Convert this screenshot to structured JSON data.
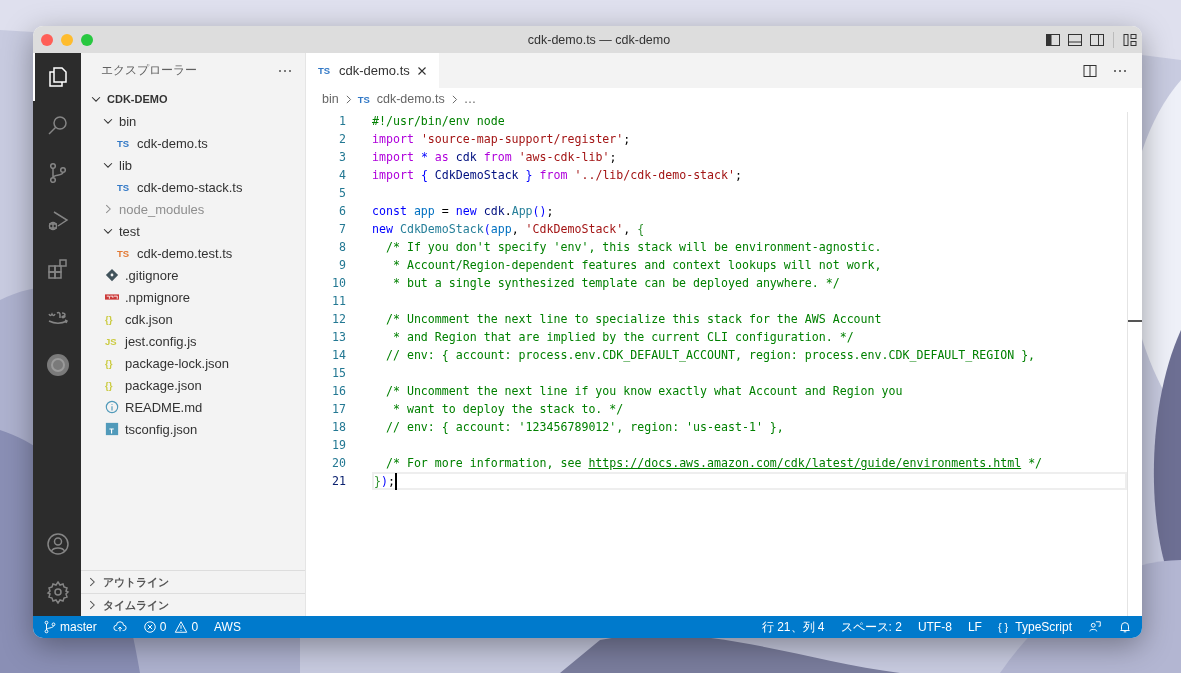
{
  "window": {
    "title": "cdk-demo.ts — cdk-demo"
  },
  "activity_bar": {
    "top": [
      {
        "selected": true
      },
      {
        "selected": false
      },
      {
        "selected": false
      },
      {
        "selected": false
      },
      {
        "selected": false
      },
      {
        "selected": false
      },
      {
        "selected": false
      }
    ]
  },
  "sidebar": {
    "title": "エクスプローラー",
    "tree": [
      {
        "label": "CDK-DEMO",
        "kind": "root",
        "expanded": true,
        "children": [
          {
            "label": "bin",
            "kind": "folder",
            "expanded": true,
            "children": [
              {
                "label": "cdk-demo.ts",
                "kind": "ts",
                "badge": "TS"
              }
            ]
          },
          {
            "label": "lib",
            "kind": "folder",
            "expanded": true,
            "children": [
              {
                "label": "cdk-demo-stack.ts",
                "kind": "ts",
                "badge": "TS"
              }
            ]
          },
          {
            "label": "node_modules",
            "kind": "folder",
            "expanded": false,
            "ignored": true
          },
          {
            "label": "test",
            "kind": "folder",
            "expanded": true,
            "children": [
              {
                "label": "cdk-demo.test.ts",
                "kind": "test",
                "badge": "TS"
              }
            ]
          },
          {
            "label": ".gitignore",
            "kind": "git"
          },
          {
            "label": ".npmignore",
            "kind": "npm"
          },
          {
            "label": "cdk.json",
            "kind": "json",
            "badge": "{}"
          },
          {
            "label": "jest.config.js",
            "kind": "js",
            "badge": "JS"
          },
          {
            "label": "package-lock.json",
            "kind": "json",
            "badge": "{}"
          },
          {
            "label": "package.json",
            "kind": "json",
            "badge": "{}"
          },
          {
            "label": "README.md",
            "kind": "info"
          },
          {
            "label": "tsconfig.json",
            "kind": "tsconfig"
          }
        ]
      }
    ],
    "panes": [
      {
        "label": "アウトライン",
        "expanded": false
      },
      {
        "label": "タイムライン",
        "expanded": false
      }
    ]
  },
  "tabs": [
    {
      "badge": "TS",
      "label": "cdk-demo.ts",
      "selected": true
    }
  ],
  "breadcrumb": [
    {
      "label": "bin"
    },
    {
      "badge": "TS",
      "label": "cdk-demo.ts"
    },
    {
      "label": "…"
    }
  ],
  "editor": {
    "lines": [
      {
        "n": "1",
        "current": false,
        "tokens": [
          {
            "kind": "comment",
            "text": "#!/usr/bin/env node"
          }
        ]
      },
      {
        "n": "2",
        "current": false,
        "tokens": [
          {
            "kind": "keyword",
            "text": "import "
          },
          {
            "kind": "string",
            "text": "'source-map-support/register'"
          },
          {
            "kind": "plain",
            "text": ";"
          }
        ]
      },
      {
        "n": "3",
        "current": false,
        "tokens": [
          {
            "kind": "keyword",
            "text": "import "
          },
          {
            "kind": "storage",
            "text": "* "
          },
          {
            "kind": "keyword",
            "text": "as "
          },
          {
            "kind": "variable",
            "text": "cdk "
          },
          {
            "kind": "keyword",
            "text": "from "
          },
          {
            "kind": "string",
            "text": "'aws-cdk-lib'"
          },
          {
            "kind": "plain",
            "text": ";"
          }
        ]
      },
      {
        "n": "4",
        "current": false,
        "tokens": [
          {
            "kind": "keyword",
            "text": "import "
          },
          {
            "kind": "storage",
            "text": "{ "
          },
          {
            "kind": "variable",
            "text": "CdkDemoStack "
          },
          {
            "kind": "storage",
            "text": "} "
          },
          {
            "kind": "keyword",
            "text": "from "
          },
          {
            "kind": "string",
            "text": "'../lib/cdk-demo-stack'"
          },
          {
            "kind": "plain",
            "text": ";"
          }
        ]
      },
      {
        "n": "5",
        "current": false
      },
      {
        "n": "6",
        "current": false,
        "tokens": [
          {
            "kind": "storage",
            "text": "const "
          },
          {
            "kind": "constant",
            "text": "app"
          },
          {
            "kind": "plain",
            "text": " = "
          },
          {
            "kind": "storage",
            "text": "new "
          },
          {
            "kind": "variable",
            "text": "cdk"
          },
          {
            "kind": "plain",
            "text": "."
          },
          {
            "kind": "type",
            "text": "App"
          },
          {
            "kind": "storage",
            "text": "()"
          },
          {
            "kind": "plain",
            "text": ";"
          }
        ]
      },
      {
        "n": "7",
        "current": false,
        "tokens": [
          {
            "kind": "storage",
            "text": "new "
          },
          {
            "kind": "type",
            "text": "CdkDemoStack"
          },
          {
            "kind": "storage",
            "text": "("
          },
          {
            "kind": "constant",
            "text": "app"
          },
          {
            "kind": "plain",
            "text": ", "
          },
          {
            "kind": "string",
            "text": "'CdkDemoStack'"
          },
          {
            "kind": "plain",
            "text": ", "
          },
          {
            "kind": "bracket",
            "text": "{"
          }
        ]
      },
      {
        "n": "8",
        "current": false,
        "tokens": [
          {
            "kind": "comment",
            "text": "  /* If you don't specify 'env', this stack will be environment-agnostic."
          }
        ]
      },
      {
        "n": "9",
        "current": false,
        "tokens": [
          {
            "kind": "comment",
            "text": "   * Account/Region-dependent features and context lookups will not work,"
          }
        ]
      },
      {
        "n": "10",
        "current": false,
        "tokens": [
          {
            "kind": "comment",
            "text": "   * but a single synthesized template can be deployed anywhere. */"
          }
        ]
      },
      {
        "n": "11",
        "current": false
      },
      {
        "n": "12",
        "current": false,
        "tokens": [
          {
            "kind": "comment",
            "text": "  /* Uncomment the next line to specialize this stack for the AWS Account"
          }
        ]
      },
      {
        "n": "13",
        "current": false,
        "tokens": [
          {
            "kind": "comment",
            "text": "   * and Region that are implied by the current CLI configuration. */"
          }
        ]
      },
      {
        "n": "14",
        "current": false,
        "tokens": [
          {
            "kind": "comment",
            "text": "  // env: { account: process.env.CDK_DEFAULT_ACCOUNT, region: process.env.CDK_DEFAULT_REGION },"
          }
        ]
      },
      {
        "n": "15",
        "current": false
      },
      {
        "n": "16",
        "current": false,
        "tokens": [
          {
            "kind": "comment",
            "text": "  /* Uncomment the next line if you know exactly what Account and Region you"
          }
        ]
      },
      {
        "n": "17",
        "current": false,
        "tokens": [
          {
            "kind": "comment",
            "text": "   * want to deploy the stack to. */"
          }
        ]
      },
      {
        "n": "18",
        "current": false,
        "tokens": [
          {
            "kind": "comment",
            "text": "  // env: { account: '123456789012', region: 'us-east-1' },"
          }
        ]
      },
      {
        "n": "19",
        "current": false
      },
      {
        "n": "20",
        "current": false,
        "tokens": [
          {
            "kind": "comment",
            "text": "  /* For more information, see "
          },
          {
            "kind": "link",
            "text": "https://docs.aws.amazon.com/cdk/latest/guide/environments.html"
          },
          {
            "kind": "comment",
            "text": " */"
          }
        ]
      },
      {
        "n": "21",
        "current": true,
        "tokens": [
          {
            "kind": "bracket",
            "text": "}"
          },
          {
            "kind": "storage",
            "text": ")"
          },
          {
            "kind": "plain",
            "text": ";"
          }
        ]
      }
    ]
  },
  "status_bar": {
    "left": [
      {
        "kind": "branch",
        "text": "master"
      },
      {
        "kind": "sync"
      },
      {
        "kind": "errors",
        "text": "0"
      },
      {
        "kind": "warnings",
        "text": "0"
      },
      {
        "kind": "plain",
        "text": "AWS"
      }
    ],
    "right": [
      {
        "kind": "plain",
        "text": "行 21、列 4"
      },
      {
        "kind": "plain",
        "text": "スペース: 2"
      },
      {
        "kind": "plain",
        "text": "UTF-8"
      },
      {
        "kind": "plain",
        "text": "LF"
      },
      {
        "kind": "language",
        "badge": "{ }",
        "text": "TypeScript"
      },
      {
        "kind": "feedback"
      },
      {
        "kind": "bell"
      }
    ]
  }
}
